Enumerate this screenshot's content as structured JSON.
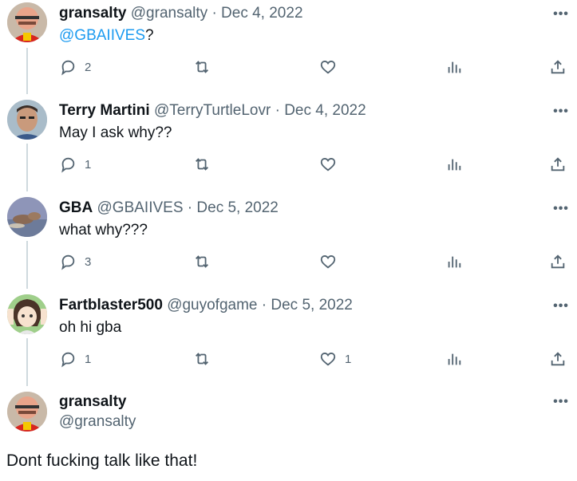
{
  "replies": [
    {
      "name": "gransalty",
      "handle": "@gransalty",
      "date": "Dec 4, 2022",
      "text_mention": "@GBAIIVES",
      "text_rest": "?",
      "reply_count": "2",
      "like_count": ""
    },
    {
      "name": "Terry Martini",
      "handle": "@TerryTurtleLovr",
      "date": "Dec 4, 2022",
      "text": "May I ask why??",
      "reply_count": "1",
      "like_count": ""
    },
    {
      "name": "GBA",
      "handle": "@GBAIIVES",
      "date": "Dec 5, 2022",
      "text": "what why???",
      "reply_count": "3",
      "like_count": ""
    },
    {
      "name": "Fartblaster500",
      "handle": "@guyofgame",
      "date": "Dec 5, 2022",
      "text": "oh hi gba",
      "reply_count": "1",
      "like_count": "1"
    }
  ],
  "main_tweet": {
    "name": "gransalty",
    "handle": "@gransalty",
    "text": "Dont fucking talk like that!"
  },
  "separator": "·",
  "more_glyph": "•••",
  "colors": {
    "text": "#0f1419",
    "secondary": "#536471",
    "link": "#1d9bf0",
    "thread_line": "#cfd9de"
  },
  "icons": [
    "reply-icon",
    "retweet-icon",
    "like-icon",
    "views-icon",
    "share-icon",
    "more-icon"
  ]
}
